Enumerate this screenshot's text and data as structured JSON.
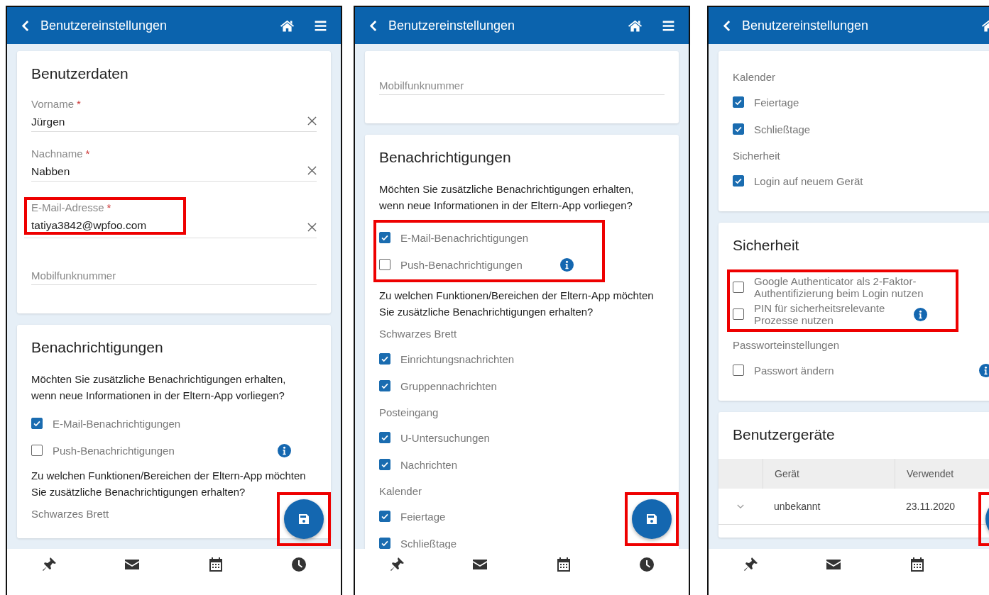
{
  "panels": [
    {
      "header": {
        "title": "Benutzereinstellungen"
      },
      "cards": [
        {
          "blocks": [
            {
              "kind": "heading",
              "text": "Benutzerdaten"
            },
            {
              "kind": "field",
              "label": "Vorname",
              "required_mark": "*",
              "value": "Jürgen",
              "highlighted": false
            },
            {
              "kind": "field",
              "label": "Nachname",
              "required_mark": "*",
              "value": "Nabben",
              "highlighted": false
            },
            {
              "kind": "field",
              "label": "E-Mail-Adresse",
              "required_mark": "*",
              "value": "tatiya3842@wpfoo.com",
              "highlighted": true
            },
            {
              "kind": "field",
              "placeholder": "Mobilfunknummer",
              "highlighted": false
            }
          ]
        },
        {
          "blocks": [
            {
              "kind": "heading",
              "text": "Benachrichtigungen"
            },
            {
              "kind": "text",
              "text": "Möchten Sie zusätzliche Benachrichtigungen erhalten, wenn neue Informationen in der Eltern-App vorliegen?"
            },
            {
              "kind": "checklist",
              "highlighted": false,
              "items": [
                {
                  "label": "E-Mail-Benachrichtigungen",
                  "checked": true,
                  "info": false
                },
                {
                  "label": "Push-Benachrichtigungen",
                  "checked": false,
                  "info": true
                }
              ]
            },
            {
              "kind": "text",
              "text": "Zu welchen Funktionen/Bereichen der Eltern-App möchten Sie zusätzliche Benachrichtigungen erhalten?"
            },
            {
              "kind": "group",
              "text": "Schwarzes Brett"
            }
          ]
        }
      ],
      "fab": {
        "highlighted": true
      }
    },
    {
      "header": {
        "title": "Benutzereinstellungen"
      },
      "cards": [
        {
          "blocks": [
            {
              "kind": "field",
              "placeholder": "Mobilfunknummer",
              "highlighted": false
            }
          ]
        },
        {
          "blocks": [
            {
              "kind": "heading",
              "text": "Benachrichtigungen"
            },
            {
              "kind": "text",
              "text": "Möchten Sie zusätzliche Benachrichtigungen erhalten, wenn neue Informationen in der Eltern-App vorliegen?"
            },
            {
              "kind": "checklist",
              "highlighted": true,
              "items": [
                {
                  "label": "E-Mail-Benachrichtigungen",
                  "checked": true,
                  "info": false
                },
                {
                  "label": "Push-Benachrichtigungen",
                  "checked": false,
                  "info": true
                }
              ]
            },
            {
              "kind": "text",
              "text": "Zu welchen Funktionen/Bereichen der Eltern-App möchten Sie zusätzliche Benachrichtigungen erhalten?"
            },
            {
              "kind": "group",
              "text": "Schwarzes Brett"
            },
            {
              "kind": "checklist",
              "highlighted": false,
              "items": [
                {
                  "label": "Einrichtungsnachrichten",
                  "checked": true,
                  "info": false
                },
                {
                  "label": "Gruppennachrichten",
                  "checked": true,
                  "info": false
                }
              ]
            },
            {
              "kind": "group",
              "text": "Posteingang"
            },
            {
              "kind": "checklist",
              "highlighted": false,
              "items": [
                {
                  "label": "U-Untersuchungen",
                  "checked": true,
                  "info": false
                },
                {
                  "label": "Nachrichten",
                  "checked": true,
                  "info": false
                }
              ]
            },
            {
              "kind": "group",
              "text": "Kalender"
            },
            {
              "kind": "checklist",
              "highlighted": false,
              "items": [
                {
                  "label": "Feiertage",
                  "checked": true,
                  "info": false
                },
                {
                  "label": "Schließtage",
                  "checked": true,
                  "info": false
                }
              ]
            }
          ]
        }
      ],
      "fab": {
        "highlighted": true
      }
    },
    {
      "header": {
        "title": "Benutzereinstellungen"
      },
      "cards": [
        {
          "blocks": [
            {
              "kind": "group",
              "text": "Kalender"
            },
            {
              "kind": "checklist",
              "highlighted": false,
              "items": [
                {
                  "label": "Feiertage",
                  "checked": true,
                  "info": false
                },
                {
                  "label": "Schließtage",
                  "checked": true,
                  "info": false
                }
              ]
            },
            {
              "kind": "group",
              "text": "Sicherheit"
            },
            {
              "kind": "checklist",
              "highlighted": false,
              "items": [
                {
                  "label": "Login auf neuem Gerät",
                  "checked": true,
                  "info": false
                }
              ]
            }
          ]
        },
        {
          "blocks": [
            {
              "kind": "heading",
              "text": "Sicherheit"
            },
            {
              "kind": "checklist",
              "highlighted": true,
              "items": [
                {
                  "label": "Google Authenticator als 2-Faktor-Authentifizierung beim Login nutzen",
                  "checked": false,
                  "info": false
                },
                {
                  "label": "PIN für sicherheitsrelevante Prozesse nutzen",
                  "checked": false,
                  "info": true
                }
              ]
            },
            {
              "kind": "group",
              "text": "Passworteinstellungen"
            },
            {
              "kind": "checklist",
              "highlighted": false,
              "items": [
                {
                  "label": "Passwort ändern",
                  "checked": false,
                  "info": true
                }
              ]
            }
          ]
        },
        {
          "blocks": [
            {
              "kind": "heading",
              "text": "Benutzergeräte"
            },
            {
              "kind": "table",
              "columns": [
                "Gerät",
                "Verwendet"
              ],
              "rows": [
                {
                  "expanded": false,
                  "cells": [
                    "unbekannt",
                    "23.11.2020"
                  ]
                }
              ]
            }
          ]
        }
      ],
      "fab": {
        "highlighted": true
      }
    }
  ]
}
